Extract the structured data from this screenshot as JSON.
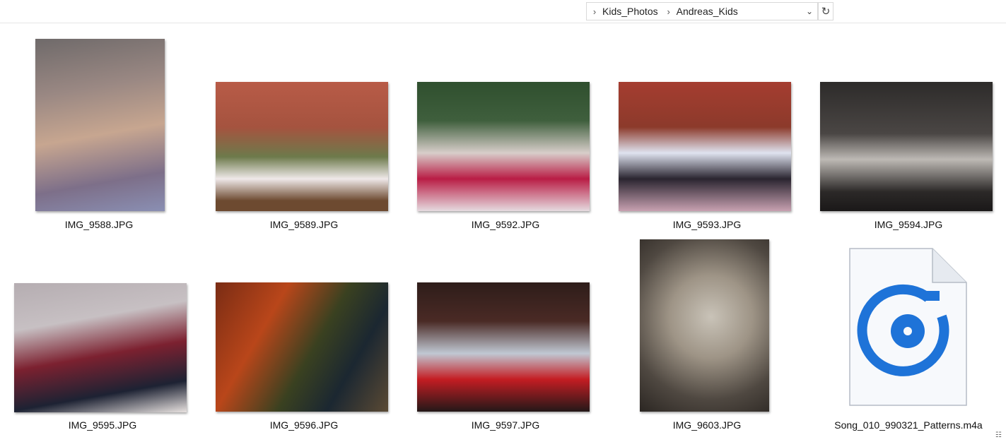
{
  "address_bar": {
    "crumbs": [
      "Kids_Photos",
      "Andreas_Kids"
    ],
    "separator_icon": "chevron-right-icon",
    "dropdown_icon": "chevron-down-icon",
    "refresh_icon": "refresh-icon"
  },
  "items": [
    {
      "name": "IMG_9588.JPG"
    },
    {
      "name": "IMG_9589.JPG"
    },
    {
      "name": "IMG_9592.JPG"
    },
    {
      "name": "IMG_9593.JPG"
    },
    {
      "name": "IMG_9594.JPG"
    },
    {
      "name": "IMG_9595.JPG"
    },
    {
      "name": "IMG_9596.JPG"
    },
    {
      "name": "IMG_9597.JPG"
    },
    {
      "name": "IMG_9603.JPG"
    },
    {
      "name": "Song_010_990321_Patterns.m4a",
      "icon": "groove-music-icon"
    }
  ],
  "colors": {
    "accent": "#1e73d8"
  }
}
